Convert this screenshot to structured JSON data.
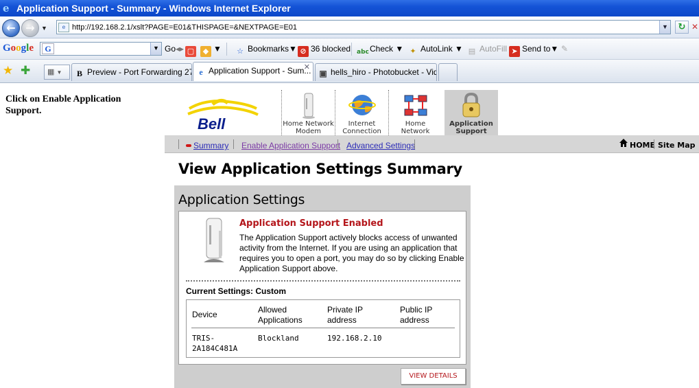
{
  "window": {
    "title": "Application Support - Summary - Windows Internet Explorer",
    "address": "http://192.168.2.1/xslt?PAGE=E01&THISPAGE=&NEXTPAGE=E01"
  },
  "google_toolbar": {
    "logo": "Google",
    "go_label": "Go",
    "bookmarks_label": "Bookmarks",
    "blocked_label": "36 blocked",
    "check_label": "Check",
    "autolink_label": "AutoLink",
    "autofill_label": "AutoFill",
    "sendto_label": "Send to"
  },
  "tabs": [
    {
      "label": "Preview - Port Forwarding 27..."
    },
    {
      "label": "Application Support - Sum..."
    },
    {
      "label": "hells_hiro - Photobucket - Vid..."
    }
  ],
  "instruction": "Click on Enable Application Support.",
  "brand": {
    "name": "Bell"
  },
  "main_nav": [
    {
      "line1": "Home Network",
      "line2": "Modem"
    },
    {
      "line1": "Internet",
      "line2": "Connection"
    },
    {
      "line1": "Home",
      "line2": "Network"
    },
    {
      "line1": "Application",
      "line2": "Support"
    }
  ],
  "sub_nav": {
    "summary": "Summary",
    "enable": "Enable Application Support",
    "advanced": "Advanced Settings",
    "home": "HOME",
    "sitemap": "Site Map"
  },
  "page_title": "View Application Settings Summary",
  "panel": {
    "title": "Application Settings",
    "status_title": "Application Support Enabled",
    "status_desc": "The Application Support actively blocks access of unwanted activity from the Internet. If you are using an application that requires you to open a port, you may do so by clicking Enable Application Support above.",
    "current_settings": "Current Settings: Custom",
    "columns": {
      "device": "Device",
      "allowed_1": "Allowed",
      "allowed_2": "Applications",
      "private_1": "Private IP",
      "private_2": "address",
      "public_1": "Public IP",
      "public_2": "address"
    },
    "row": {
      "device_1": "TRIS-",
      "device_2": "2A184C481A",
      "app": "Blockland",
      "private_ip": "192.168.2.10",
      "public_ip": ""
    },
    "view_details": "VIEW DETAILS"
  }
}
